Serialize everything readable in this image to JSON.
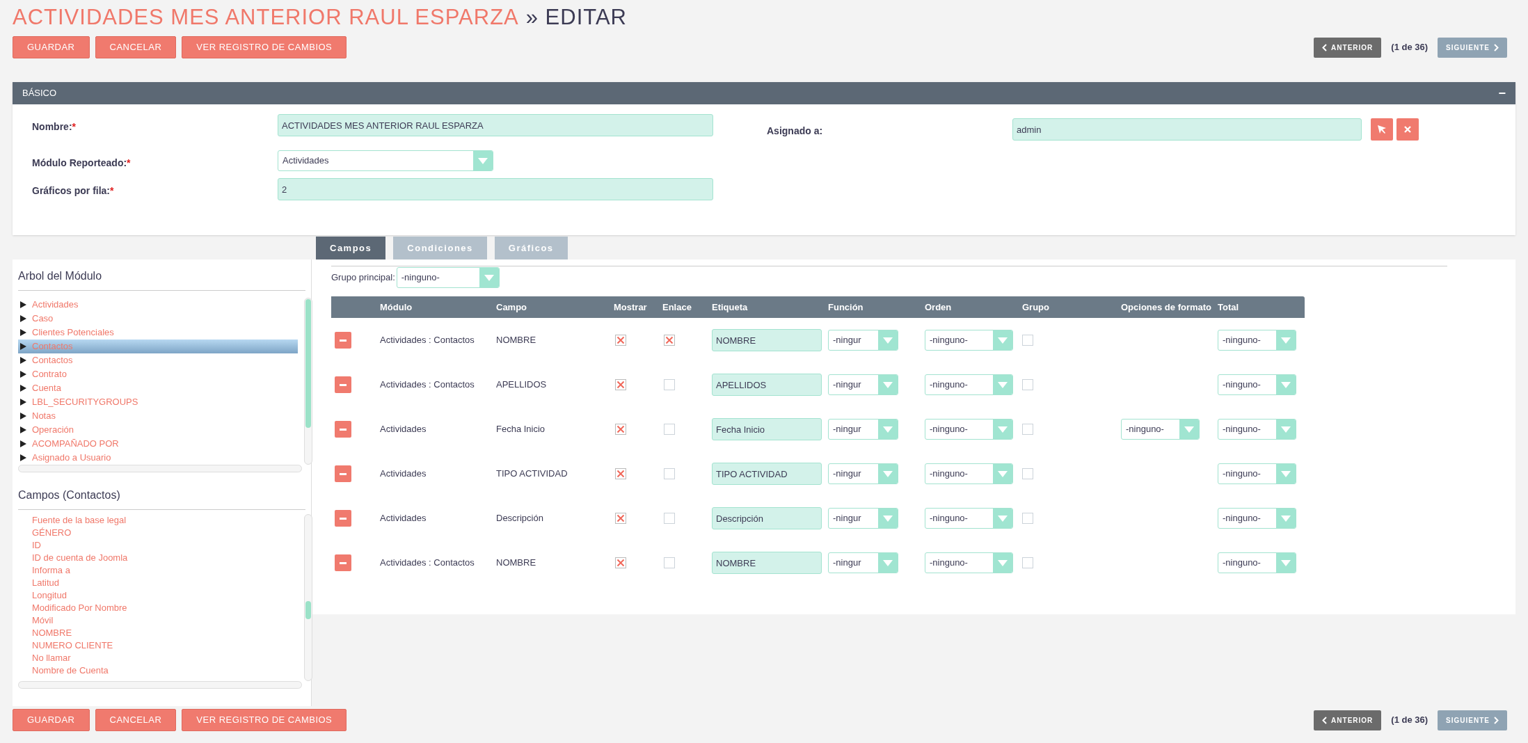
{
  "title": {
    "record": "ACTIVIDADES MES ANTERIOR RAUL ESPARZA",
    "suffix": "» EDITAR"
  },
  "top_actions": [
    "GUARDAR",
    "CANCELAR",
    "VER REGISTRO DE CAMBIOS"
  ],
  "top_nav": {
    "previous": "ANTERIOR",
    "counter": "(1 de 36)",
    "next": "SIGUIENTE"
  },
  "panel": {
    "title": "BÁSICO",
    "collapse": "−",
    "left_fields": [
      {
        "kind": "text",
        "label": "Nombre:",
        "required_mark": "*",
        "value": "ACTIVIDADES MES ANTERIOR RAUL ESPARZA"
      },
      {
        "kind": "select",
        "label": "Módulo Reporteado:",
        "required_mark": "*",
        "value": "Actividades"
      },
      {
        "kind": "text",
        "label": "Gráficos por fila:",
        "required_mark": "*",
        "value": "2"
      }
    ],
    "right_fields": [
      {
        "kind": "relate",
        "label": "Asignado a:",
        "value": "admin"
      }
    ]
  },
  "tabs": [
    {
      "label": "Campos",
      "selected": true
    },
    {
      "label": "Condiciones",
      "selected": false
    },
    {
      "label": "Gráficos",
      "selected": false
    }
  ],
  "module_tree": {
    "title": "Arbol del Módulo",
    "items": [
      {
        "label": "Actividades",
        "selected": false
      },
      {
        "label": "Caso",
        "selected": false
      },
      {
        "label": "Clientes Potenciales",
        "selected": false
      },
      {
        "label": "Contactos",
        "selected": true
      },
      {
        "label": "Contactos",
        "selected": false
      },
      {
        "label": "Contrato",
        "selected": false
      },
      {
        "label": "Cuenta",
        "selected": false
      },
      {
        "label": "LBL_SECURITYGROUPS",
        "selected": false
      },
      {
        "label": "Notas",
        "selected": false
      },
      {
        "label": "Operación",
        "selected": false
      },
      {
        "label": "ACOMPAÑADO POR",
        "selected": false
      },
      {
        "label": "Asignado a Usuario",
        "selected": false
      }
    ]
  },
  "fields_list": {
    "title": "Campos (Contactos)",
    "items": [
      "Fuente de la base legal",
      "GÉNERO",
      "ID",
      "ID de cuenta de Joomla",
      "Informa a",
      "Latitud",
      "Longitud",
      "Modificado Por Nombre",
      "Móvil",
      "NOMBRE",
      "NUMERO CLIENTE",
      "No llamar",
      "Nombre de Cuenta"
    ]
  },
  "main_group": {
    "label": "Grupo principal:",
    "value": "-ninguno-"
  },
  "table": {
    "columns": [
      "Módulo",
      "Campo",
      "Mostrar",
      "Enlace",
      "Etiqueta",
      "Función",
      "Orden",
      "Grupo",
      "Opciones de formato",
      "Total"
    ],
    "rows": [
      {
        "module": "Actividades : Contactos",
        "field": "NOMBRE",
        "show": true,
        "link": true,
        "label": "NOMBRE",
        "function": "-ningur",
        "order": "-ninguno-",
        "group": false,
        "total": "-ninguno-"
      },
      {
        "module": "Actividades : Contactos",
        "field": "APELLIDOS",
        "show": true,
        "link": false,
        "label": "APELLIDOS",
        "function": "-ningur",
        "order": "-ninguno-",
        "group": false,
        "total": "-ninguno-"
      },
      {
        "module": "Actividades",
        "field": "Fecha Inicio",
        "show": true,
        "link": false,
        "label": "Fecha Inicio",
        "function": "-ningur",
        "order": "-ninguno-",
        "group": false,
        "format": "-ninguno-",
        "total": "-ninguno-"
      },
      {
        "module": "Actividades",
        "field": "TIPO ACTIVIDAD",
        "show": true,
        "link": false,
        "label": "TIPO ACTIVIDAD",
        "function": "-ningur",
        "order": "-ninguno-",
        "group": false,
        "total": "-ninguno-"
      },
      {
        "module": "Actividades",
        "field": "Descripción",
        "show": true,
        "link": false,
        "label": "Descripción",
        "function": "-ningur",
        "order": "-ninguno-",
        "group": false,
        "total": "-ninguno-"
      },
      {
        "module": "Actividades : Contactos",
        "field": "NOMBRE",
        "show": true,
        "link": false,
        "label": "NOMBRE",
        "function": "-ningur",
        "order": "-ninguno-",
        "group": false,
        "total": "-ninguno-"
      }
    ]
  },
  "bottom_actions": [
    "GUARDAR",
    "CANCELAR",
    "VER REGISTRO DE CAMBIOS"
  ],
  "bottom_nav": {
    "previous": "ANTERIOR",
    "counter": "(1 de 36)",
    "next": "SIGUIENTE"
  }
}
